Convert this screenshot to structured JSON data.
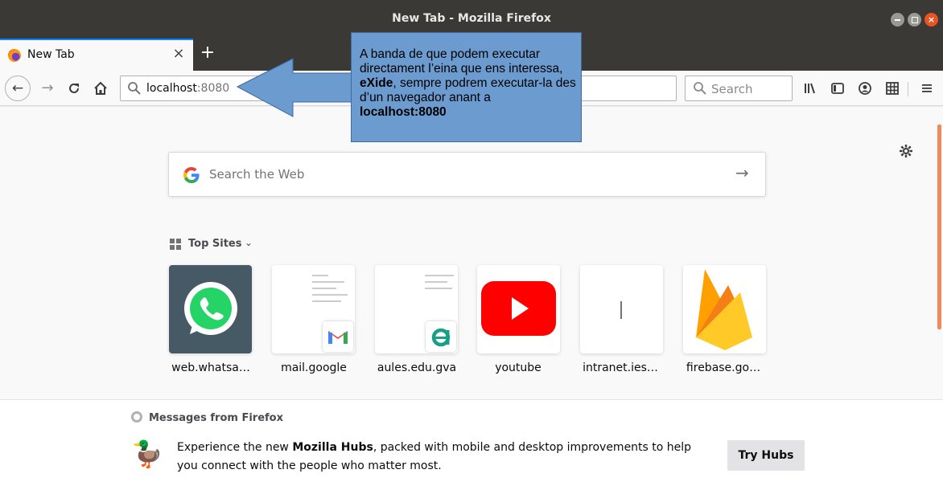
{
  "window": {
    "title": "New Tab - Mozilla Firefox"
  },
  "tab": {
    "label": "New Tab",
    "close_glyph": "×",
    "new_tab_glyph": "+"
  },
  "nav": {
    "back_glyph": "←",
    "forward_glyph": "→",
    "reload_glyph": "C",
    "home_glyph": "⌂",
    "url_host": "localhost",
    "url_port": ":8080",
    "search_placeholder": "Search"
  },
  "newtab": {
    "web_search_placeholder": "Search the Web",
    "top_sites_label": "Top Sites",
    "top_sites": [
      {
        "label": "web.whatsa…",
        "icon": "whatsapp-icon"
      },
      {
        "label": "mail.google",
        "icon": "gmail-icon"
      },
      {
        "label": "aules.edu.gva",
        "icon": "aules-icon"
      },
      {
        "label": "youtube",
        "icon": "youtube-icon"
      },
      {
        "label": "intranet.ies…",
        "icon": "blank-page-icon"
      },
      {
        "label": "firebase.go…",
        "icon": "firebase-icon"
      }
    ],
    "messages_header": "Messages from Firefox",
    "message_pre": "Experience the new ",
    "message_bold": "Mozilla Hubs",
    "message_post": ", packed with mobile and desktop improvements to help you connect with the people who matter most.",
    "message_button": "Try Hubs"
  },
  "callout": {
    "part1": "A banda de que podem executar directament l’eina que ens interessa, ",
    "bold1": "eXide",
    "part2": ", sempre podrem executar-la des d’un navegador anant a ",
    "bold2": "localhost:8080"
  },
  "colors": {
    "titlebar": "#3a3936",
    "accent_tab": "#0a84ff",
    "callout_fill": "#6c9bd0",
    "close_button": "#e95420"
  }
}
